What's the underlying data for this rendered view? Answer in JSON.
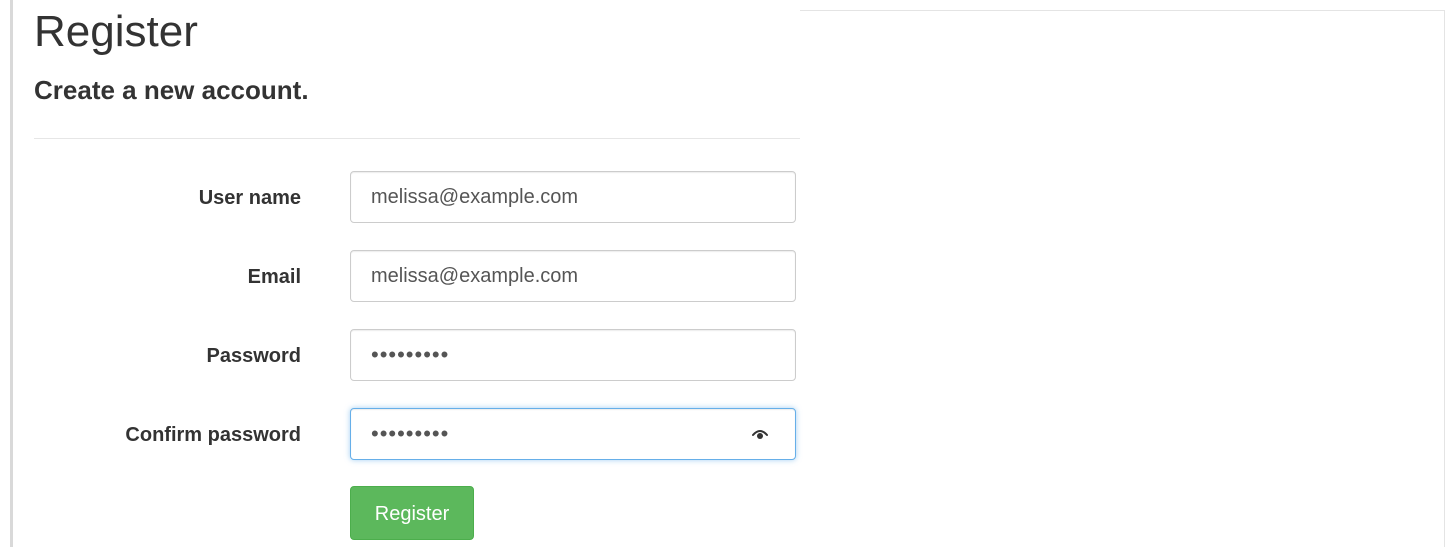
{
  "page": {
    "title": "Register",
    "subtitle": "Create a new account."
  },
  "form": {
    "username": {
      "label": "User name",
      "value": "melissa@example.com"
    },
    "email": {
      "label": "Email",
      "value": "melissa@example.com"
    },
    "password": {
      "label": "Password",
      "value": "•••••••••"
    },
    "confirm_password": {
      "label": "Confirm password",
      "value": "•••••••••",
      "focused": true,
      "reveal_icon": "eye-icon"
    },
    "submit_label": "Register"
  },
  "colors": {
    "primary_button": "#5cb85c",
    "focus_border": "#66afe9",
    "text": "#333333"
  }
}
